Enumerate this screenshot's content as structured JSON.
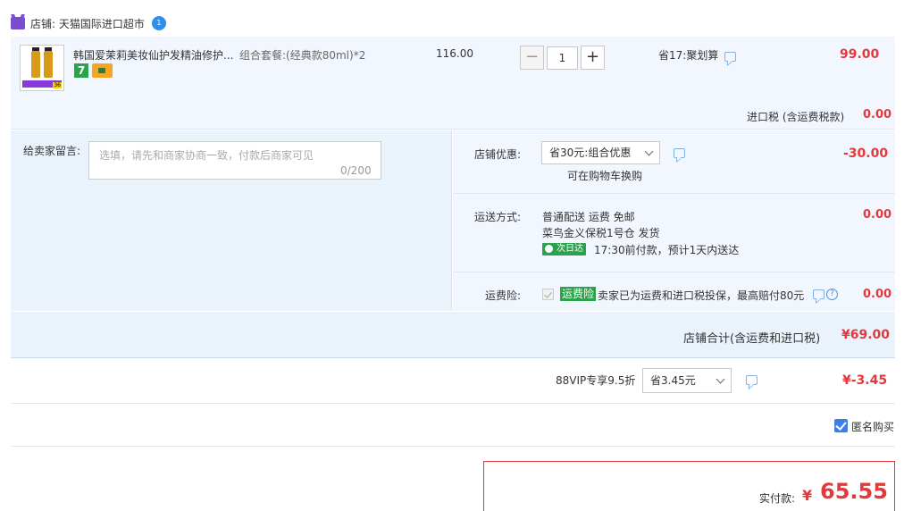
{
  "shop": {
    "label": "店铺: 天猫国际进口超市",
    "badge": "1"
  },
  "item": {
    "title": "韩国爱茉莉美妆仙护发精油修护...",
    "package": "组合套餐:(经典款80ml)*2",
    "tag_seven": "7",
    "thumb_num": "36",
    "unit_price": "116.00",
    "qty_minus": "−",
    "quantity": "1",
    "qty_plus": "+",
    "saving": "省17:聚划算",
    "price": "99.00",
    "tax_label": "进口税 (含运费税款)",
    "tax_value": "0.00"
  },
  "message": {
    "label": "给卖家留言:",
    "placeholder": "选填，请先和商家协商一致，付款后商家可见",
    "count": "0/200"
  },
  "shop_discount": {
    "label": "店铺优惠:",
    "selected": "省30元:组合优惠",
    "note": "可在购物车换购",
    "value": "-30.00"
  },
  "shipping": {
    "label": "运送方式:",
    "line1": "普通配送 运费 免邮",
    "line2": "菜鸟金义保税1号仓  发货",
    "next_day": "次日达",
    "time": "17:30前付款，预计1天内送达",
    "value": "0.00"
  },
  "insurance": {
    "label": "运费险:",
    "tag": "运费险",
    "text": "卖家已为运费和进口税投保，最高赔付80元",
    "help": "?",
    "value": "0.00"
  },
  "shop_total": {
    "label": "店铺合计(含运费和进口税)",
    "value": "¥69.00"
  },
  "vip": {
    "label": "88VIP专享9.5折",
    "selected": "省3.45元",
    "value": "¥-3.45"
  },
  "anonymous": {
    "label": "匿名购买",
    "checked": true
  },
  "payment": {
    "label": "实付款:",
    "currency": "¥",
    "value": "65.55"
  },
  "colors": {
    "accent_red": "#e4393c",
    "panel_blue": "#f2f7ff",
    "tag_green": "#2ba24c",
    "check_blue": "#3d7ee8"
  }
}
